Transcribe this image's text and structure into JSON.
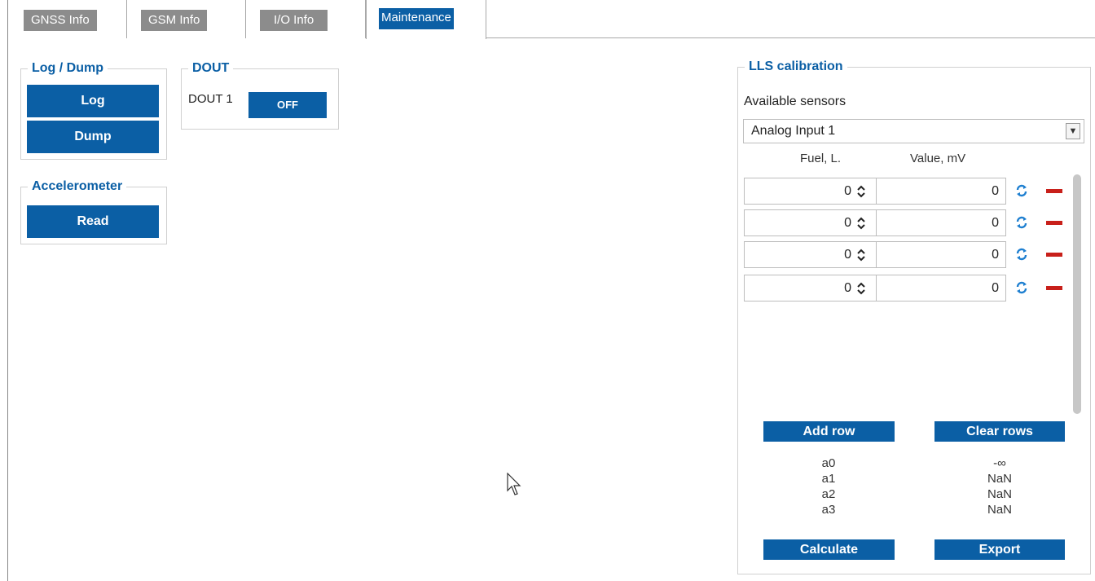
{
  "tabs": [
    {
      "label": "GNSS Info",
      "active": false
    },
    {
      "label": "GSM Info",
      "active": false
    },
    {
      "label": "I/O Info",
      "active": false
    },
    {
      "label": "Maintenance",
      "active": true
    }
  ],
  "log_dump": {
    "title": "Log / Dump",
    "log_label": "Log",
    "dump_label": "Dump"
  },
  "dout": {
    "title": "DOUT",
    "label": "DOUT 1",
    "button": "OFF"
  },
  "accelerometer": {
    "title": "Accelerometer",
    "read_label": "Read"
  },
  "lls": {
    "title": "LLS calibration",
    "available_label": "Available sensors",
    "selected_sensor": "Analog Input 1",
    "col_fuel": "Fuel, L.",
    "col_value": "Value, mV",
    "rows": [
      {
        "fuel": "0",
        "value": "0"
      },
      {
        "fuel": "0",
        "value": "0"
      },
      {
        "fuel": "0",
        "value": "0"
      },
      {
        "fuel": "0",
        "value": "0"
      }
    ],
    "add_row": "Add row",
    "clear_rows": "Clear rows",
    "coefficients": [
      {
        "name": "a0",
        "value": "-∞"
      },
      {
        "name": "a1",
        "value": "NaN"
      },
      {
        "name": "a2",
        "value": "NaN"
      },
      {
        "name": "a3",
        "value": "NaN"
      }
    ],
    "calculate": "Calculate",
    "export": "Export"
  },
  "colors": {
    "accent": "#0b5fa5",
    "tab_inactive": "#8c8c8c",
    "delete": "#c8201a"
  }
}
